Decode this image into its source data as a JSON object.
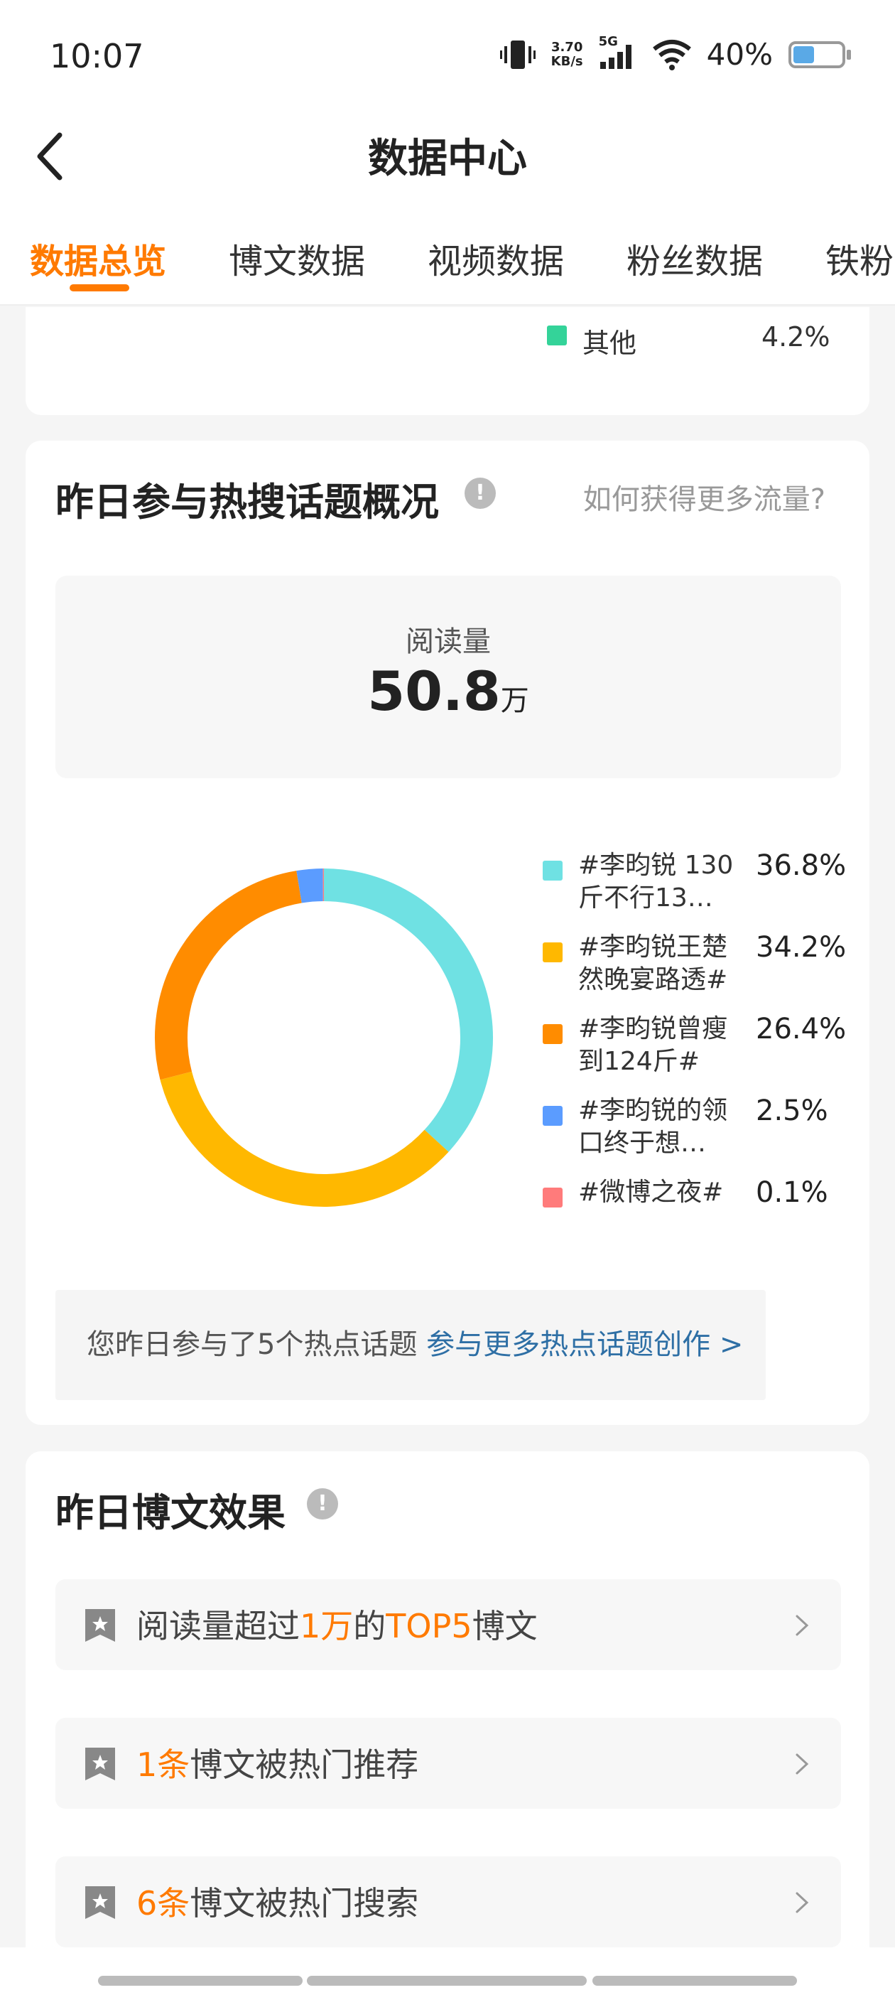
{
  "status_bar": {
    "time": "10:07",
    "net_speed_top": "3.70",
    "net_speed_bottom": "KB/s",
    "network": "5G",
    "battery": "40%",
    "battery_level": 0.4
  },
  "nav": {
    "title": "数据中心"
  },
  "tabs": [
    {
      "label": "数据总览",
      "active": true
    },
    {
      "label": "博文数据"
    },
    {
      "label": "视频数据"
    },
    {
      "label": "粉丝数据"
    },
    {
      "label": "铁粉"
    }
  ],
  "prev_card": {
    "legend_label": "其他",
    "legend_pct": "4.2%",
    "color": "#34d399"
  },
  "hot_topics": {
    "title": "昨日参与热搜话题概况",
    "info_icon": "!",
    "link": "如何获得更多流量?",
    "read_label": "阅读量",
    "read_value": "50.8",
    "read_unit": "万",
    "note_text": "您昨日参与了5个热点话题 ",
    "note_link": "参与更多热点话题创作 >"
  },
  "chart_data": {
    "type": "pie",
    "categories": [
      "#李昀锐 130斤不行13…",
      "#李昀锐王楚然晚宴路透#",
      "#李昀锐曾瘦到124斤#",
      "#李昀锐的领口终于想…",
      "#微博之夜#"
    ],
    "values": [
      36.8,
      34.2,
      26.4,
      2.5,
      0.1
    ],
    "labels": [
      "36.8%",
      "34.2%",
      "26.4%",
      "2.5%",
      "0.1%"
    ],
    "colors": [
      "#6fe1e3",
      "#ffb800",
      "#ff8c00",
      "#5b9cff",
      "#ff7b7b"
    ]
  },
  "legend_lines": [
    [
      "#李昀锐 130",
      "斤不行13…"
    ],
    [
      "#李昀锐王楚",
      "然晚宴路透#"
    ],
    [
      "#李昀锐曾瘦",
      "到124斤#"
    ],
    [
      "#李昀锐的领",
      "口终于想…"
    ],
    [
      "#微博之夜#",
      ""
    ]
  ],
  "post_effect": {
    "title": "昨日博文效果",
    "info_icon": "!",
    "items": [
      {
        "pre": "阅读量超过",
        "hl1": "1万",
        "mid": "的",
        "hl2": "TOP5",
        "post": "博文"
      },
      {
        "pre": "",
        "hl1": "1条",
        "mid": "博文被热门推荐",
        "hl2": "",
        "post": ""
      },
      {
        "pre": "",
        "hl1": "6条",
        "mid": "博文被热门搜索",
        "hl2": "",
        "post": ""
      }
    ]
  }
}
